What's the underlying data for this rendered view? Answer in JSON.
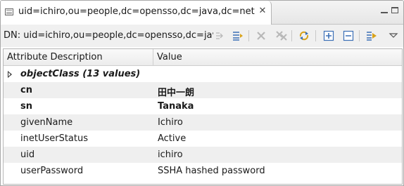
{
  "editor": {
    "tab_title": "uid=ichiro,ou=people,dc=opensso,dc=java,dc=net",
    "tab_close_glyph": "✕"
  },
  "dn_bar": {
    "label": "DN: uid=ichiro,ou=people,dc=opensso,dc=java,dc=net"
  },
  "toolbar": {
    "buttons": [
      {
        "name": "new-value-icon",
        "enabled": false
      },
      {
        "name": "new-attribute-icon",
        "enabled": true
      },
      {
        "name": "delete-icon",
        "enabled": false
      },
      {
        "name": "delete-all-icon",
        "enabled": false
      },
      {
        "name": "refresh-icon",
        "enabled": true
      },
      {
        "name": "expand-all-icon",
        "enabled": true
      },
      {
        "name": "collapse-all-icon",
        "enabled": true
      },
      {
        "name": "show-decorated-values-icon",
        "enabled": true
      },
      {
        "name": "view-menu-icon",
        "enabled": true
      }
    ]
  },
  "table": {
    "columns": [
      "Attribute Description",
      "Value"
    ],
    "rows": [
      {
        "attribute": "objectClass (13 values)",
        "value": "",
        "style": "bolditalic",
        "expandable": true
      },
      {
        "attribute": "cn",
        "value": "田中一朗",
        "style": "bold"
      },
      {
        "attribute": "sn",
        "value": "Tanaka",
        "style": "bold"
      },
      {
        "attribute": "givenName",
        "value": "Ichiro",
        "style": "normal"
      },
      {
        "attribute": "inetUserStatus",
        "value": "Active",
        "style": "normal"
      },
      {
        "attribute": "uid",
        "value": "ichiro",
        "style": "normal"
      },
      {
        "attribute": "userPassword",
        "value": "SSHA hashed password",
        "style": "normal"
      }
    ]
  },
  "colors": {
    "icon_blue": "#3b6fb6",
    "icon_gold": "#d8a21a",
    "icon_disabled": "#b8b8b8",
    "alt_row": "#efefef"
  }
}
